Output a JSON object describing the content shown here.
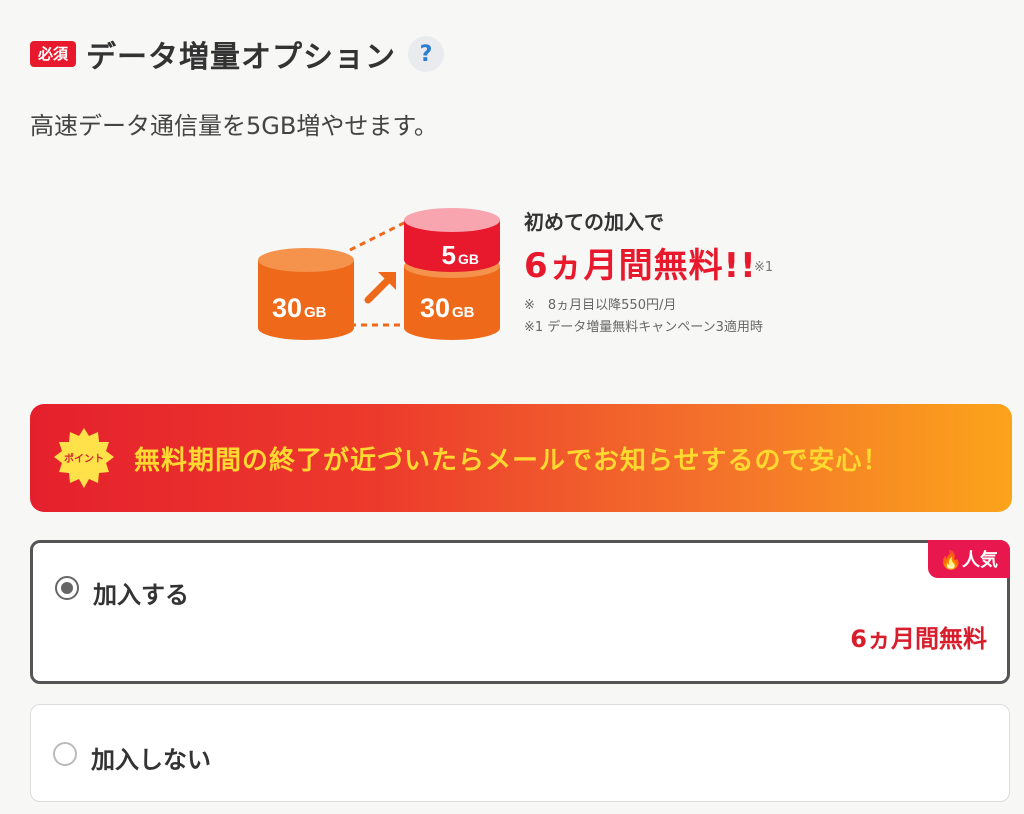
{
  "header": {
    "badge": "必須",
    "title": "データ増量オプション",
    "help": "?"
  },
  "description": "高速データ通信量を5GB増やせます。",
  "illustration": {
    "base_label": "30",
    "base_unit": "GB",
    "added_label": "5",
    "added_unit": "GB",
    "result_label": "30",
    "result_unit": "GB"
  },
  "promo": {
    "lead": "初めての加入で",
    "headline": "6ヵ月間無料!!",
    "mark": "※1",
    "note1": "※　8ヵ月目以降550円/月",
    "note2": "※1 データ増量無料キャンペーン3適用時"
  },
  "point_banner": {
    "badge": "ポイント",
    "text": "無料期間の終了が近づいたらメールでお知らせするので安心！"
  },
  "options": [
    {
      "label": "加入する",
      "price": "6ヵ月間無料",
      "tag": "人気",
      "selected": true
    },
    {
      "label": "加入しない",
      "selected": false
    }
  ],
  "colors": {
    "accent_red": "#e8192c",
    "banner_yellow": "#ffd830",
    "cylinder_orange": "#ee6a1a"
  }
}
